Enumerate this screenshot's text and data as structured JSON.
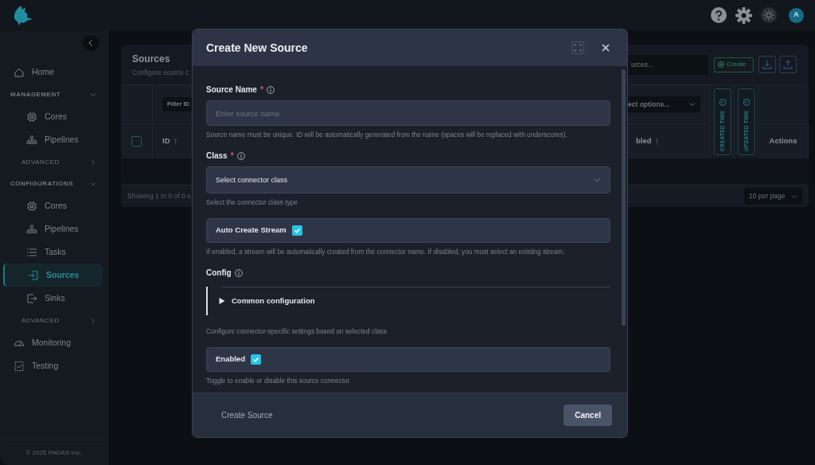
{
  "topbar": {
    "avatar": "A"
  },
  "sidebar": {
    "items": [
      {
        "kind": "link",
        "label": "Home",
        "selected": false
      },
      {
        "kind": "section",
        "label": "MANAGEMENT",
        "expanded": true,
        "children": [
          {
            "kind": "link",
            "label": "Cores",
            "selected": false
          },
          {
            "kind": "link",
            "label": "Pipelines",
            "selected": false
          },
          {
            "kind": "section",
            "label": "ADVANCED",
            "expanded": false
          }
        ]
      },
      {
        "kind": "section",
        "label": "CONFIGURATIONS",
        "expanded": true,
        "children": [
          {
            "kind": "link",
            "label": "Cores",
            "selected": false
          },
          {
            "kind": "link",
            "label": "Pipelines",
            "selected": false
          },
          {
            "kind": "link",
            "label": "Tasks",
            "selected": false
          },
          {
            "kind": "link",
            "label": "Sources",
            "selected": true
          },
          {
            "kind": "link",
            "label": "Sinks",
            "selected": false
          },
          {
            "kind": "section",
            "label": "ADVANCED",
            "expanded": false
          }
        ]
      },
      {
        "kind": "link",
        "label": "Monitoring",
        "selected": false
      },
      {
        "kind": "link",
        "label": "Testing",
        "selected": false
      }
    ],
    "footer": "© 2025 PADAS Inc."
  },
  "page": {
    "title": "Sources",
    "subtitle": "Configure source c",
    "search": {
      "placeholder": "urces..."
    },
    "create_button": "Create",
    "table": {
      "filters": {
        "id": "Filter ID",
        "enabled": "ect options..."
      },
      "columns": [
        {
          "label": "ID",
          "kind": "sort"
        },
        {
          "label": "bled",
          "kind": "sort"
        },
        {
          "label": "CREATED TIME",
          "kind": "time"
        },
        {
          "label": "UPDATED TIME",
          "kind": "time"
        },
        {
          "label": "Actions",
          "kind": "plain"
        }
      ],
      "select_all": {
        "checked": false
      }
    },
    "footer": {
      "summary": "Showing 1 to 0 of 0 e",
      "page_size": "10 per page"
    }
  },
  "modal": {
    "title": "Create New Source",
    "fields": [
      {
        "kind": "text",
        "label": "Source Name",
        "required_marker": "*",
        "info": true,
        "placeholder": "Enter source name",
        "help": "Source name must be unique. ID will be automatically generated from the name (spaces will be replaced with underscores)."
      },
      {
        "kind": "select",
        "label": "Class",
        "required_marker": "*",
        "info": true,
        "placeholder": "Select connector class",
        "help": "Select the connector class type"
      },
      {
        "kind": "checkbox",
        "label": "Auto Create Stream",
        "checked": true,
        "help": "If enabled, a stream will be automatically created from the connector name. If disabled, you must select an existing stream."
      },
      {
        "kind": "heading",
        "label": "Config",
        "info": true
      },
      {
        "kind": "details",
        "label": "Common configuration",
        "expanded": false,
        "help": "Configure connector-specific settings based on selected class"
      },
      {
        "kind": "checkbox",
        "label": "Enabled",
        "checked": true,
        "help": "Toggle to enable or disable this source connector"
      }
    ],
    "buttons": [
      {
        "label": "Create Source",
        "disabled": true
      },
      {
        "label": "Cancel",
        "disabled": false
      }
    ]
  }
}
